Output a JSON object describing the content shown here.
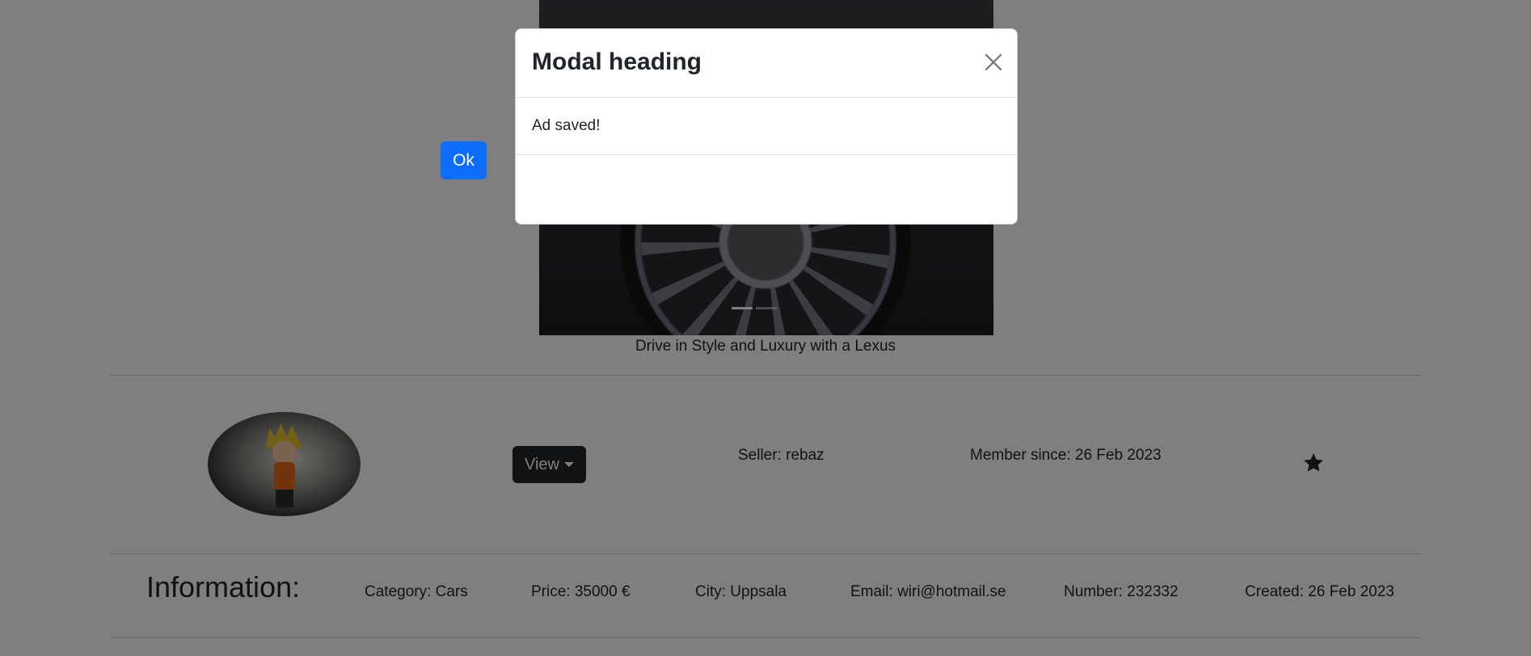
{
  "carousel": {
    "caption": "Drive in Style and Luxury with a Lexus",
    "prev_icon": "chevron-left-icon",
    "next_icon": "chevron-right-icon",
    "prev_glyph": "‹",
    "next_glyph": "›"
  },
  "seller_row": {
    "view_label": "View",
    "seller": "Seller: rebaz",
    "member_since": "Member since: 26 Feb 2023",
    "favorite_icon": "star-icon"
  },
  "information": {
    "title": "Information:",
    "category": "Category: Cars",
    "price": "Price: 35000 €",
    "city": "City: Uppsala",
    "email": "Email: wiri@hotmail.se",
    "number": "Number: 232332",
    "created": "Created: 26 Feb 2023"
  },
  "modal": {
    "title": "Modal heading",
    "body": "Ad saved!",
    "ok_label": "Ok",
    "close_icon": "close-icon"
  },
  "colors": {
    "primary": "#0d6efd",
    "dark_button": "#212529",
    "backdrop": "rgba(0,0,0,0.5)"
  }
}
